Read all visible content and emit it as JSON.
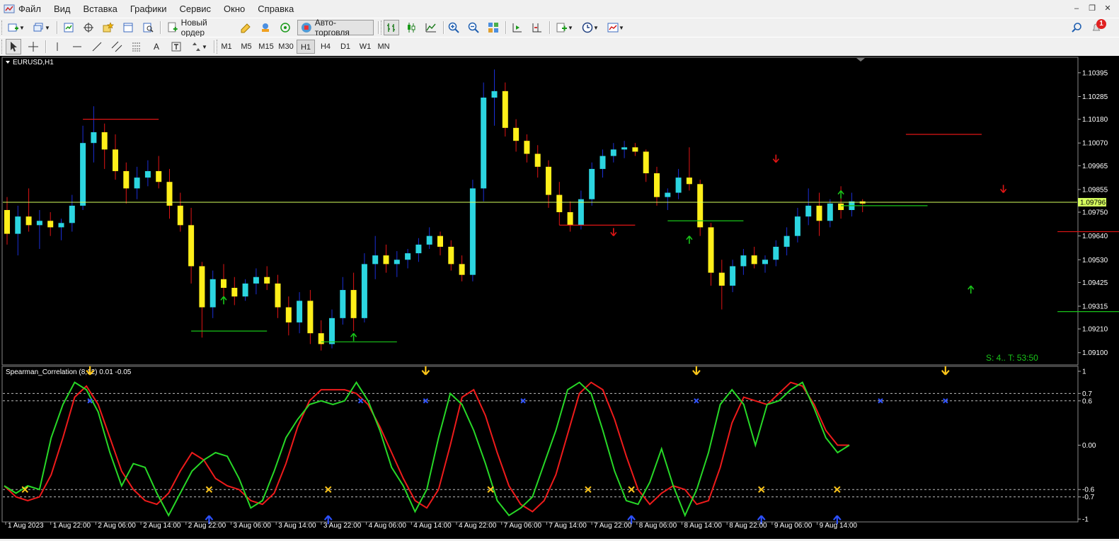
{
  "menu": {
    "items": [
      "Файл",
      "Вид",
      "Вставка",
      "Графики",
      "Сервис",
      "Окно",
      "Справка"
    ]
  },
  "toolbar": {
    "new_order_label": "Новый ордер",
    "autotrading_label": "Авто-торговля",
    "notification_count": "1"
  },
  "timeframes": [
    "M1",
    "M5",
    "M15",
    "M30",
    "H1",
    "H4",
    "D1",
    "W1",
    "MN"
  ],
  "active_timeframe": "H1",
  "chart": {
    "symbol_label": "EURUSD,H1",
    "current_price": "1.09796",
    "timer_text": "S: 4.. T: 53:50",
    "price_ticks": [
      "1.10395",
      "1.10285",
      "1.10180",
      "1.10070",
      "1.09965",
      "1.09855",
      "1.09750",
      "1.09640",
      "1.09530",
      "1.09425",
      "1.09315",
      "1.09210",
      "1.09100"
    ],
    "price_range": [
      1.0905,
      1.1046
    ],
    "colors": {
      "bull": "#2cd5e0",
      "bear": "#ffef1a",
      "bull_wick": "#1a2fd6",
      "bear_wick": "#e01515",
      "bid_line": "#d6ff5e",
      "level_red": "#e01515",
      "level_green": "#19c419"
    },
    "candles": [
      [
        1.0976,
        1.0982,
        1.096,
        1.0965
      ],
      [
        1.0965,
        1.0978,
        1.0955,
        1.0973
      ],
      [
        1.0973,
        1.0986,
        1.0966,
        1.0969
      ],
      [
        1.0969,
        1.0976,
        1.0958,
        1.0971
      ],
      [
        1.0971,
        1.0975,
        1.0964,
        1.0968
      ],
      [
        1.0968,
        1.0972,
        1.0962,
        1.097
      ],
      [
        1.097,
        1.0983,
        1.0966,
        1.0978
      ],
      [
        1.0978,
        1.1015,
        1.0976,
        1.1007
      ],
      [
        1.1007,
        1.1024,
        1.0998,
        1.1012
      ],
      [
        1.1012,
        1.1016,
        1.0995,
        1.1004
      ],
      [
        1.1004,
        1.1011,
        1.099,
        1.0994
      ],
      [
        1.0994,
        1.0998,
        1.0979,
        1.0986
      ],
      [
        1.0986,
        1.0996,
        1.0981,
        1.0991
      ],
      [
        1.0991,
        1.0999,
        1.0987,
        1.0994
      ],
      [
        1.0994,
        1.1001,
        1.0986,
        1.0989
      ],
      [
        1.0989,
        1.0995,
        1.0972,
        1.0978
      ],
      [
        1.0978,
        1.0984,
        1.0966,
        1.0969
      ],
      [
        1.0969,
        1.0977,
        1.0942,
        1.095
      ],
      [
        1.095,
        1.0952,
        1.0917,
        1.0931
      ],
      [
        1.0931,
        1.0948,
        1.0926,
        1.0944
      ],
      [
        1.0944,
        1.0951,
        1.0936,
        1.094
      ],
      [
        1.094,
        1.0945,
        1.0932,
        1.0936
      ],
      [
        1.0936,
        1.0944,
        1.0934,
        1.0942
      ],
      [
        1.0942,
        1.0949,
        1.0937,
        1.0945
      ],
      [
        1.0945,
        1.095,
        1.0939,
        1.0942
      ],
      [
        1.0942,
        1.0946,
        1.0926,
        1.0931
      ],
      [
        1.0931,
        1.0936,
        1.0918,
        1.0924
      ],
      [
        1.0924,
        1.0938,
        1.0919,
        1.0934
      ],
      [
        1.0934,
        1.0939,
        1.0914,
        1.0919
      ],
      [
        1.0919,
        1.0925,
        1.0911,
        1.0914
      ],
      [
        1.0914,
        1.093,
        1.0912,
        1.0926
      ],
      [
        1.0926,
        1.0945,
        1.0923,
        1.0939
      ],
      [
        1.0939,
        1.0947,
        1.092,
        1.0926
      ],
      [
        1.0926,
        1.0956,
        1.0924,
        1.0951
      ],
      [
        1.0951,
        1.0964,
        1.0944,
        1.0955
      ],
      [
        1.0955,
        1.096,
        1.0947,
        1.0951
      ],
      [
        1.0951,
        1.0957,
        1.0945,
        1.0953
      ],
      [
        1.0953,
        1.0958,
        1.0949,
        1.0956
      ],
      [
        1.0956,
        1.0963,
        1.0952,
        1.096
      ],
      [
        1.096,
        1.0968,
        1.0958,
        1.0964
      ],
      [
        1.0964,
        1.0966,
        1.0955,
        1.0959
      ],
      [
        1.0959,
        1.0962,
        1.0948,
        1.0951
      ],
      [
        1.0951,
        1.0955,
        1.0943,
        1.0946
      ],
      [
        1.0946,
        1.099,
        1.0943,
        1.0986
      ],
      [
        1.0986,
        1.1035,
        1.098,
        1.1028
      ],
      [
        1.1028,
        1.1041,
        1.1015,
        1.1031
      ],
      [
        1.1031,
        1.1035,
        1.101,
        1.1014
      ],
      [
        1.1014,
        1.1018,
        1.1003,
        1.1008
      ],
      [
        1.1008,
        1.1011,
        1.0998,
        1.1002
      ],
      [
        1.1002,
        1.1006,
        1.0991,
        1.0996
      ],
      [
        1.0996,
        1.0999,
        1.0977,
        1.0983
      ],
      [
        1.0983,
        1.0989,
        1.0969,
        1.0975
      ],
      [
        1.0975,
        1.098,
        1.0966,
        1.0969
      ],
      [
        1.0969,
        1.0985,
        1.0967,
        1.0981
      ],
      [
        1.0981,
        1.0998,
        1.0978,
        1.0995
      ],
      [
        1.0995,
        1.1004,
        1.0991,
        1.1001
      ],
      [
        1.1001,
        1.1007,
        1.0998,
        1.1004
      ],
      [
        1.1004,
        1.1008,
        1.1,
        1.1005
      ],
      [
        1.1005,
        1.1007,
        1.1001,
        1.1003
      ],
      [
        1.1003,
        1.1004,
        1.0989,
        1.0993
      ],
      [
        1.0993,
        1.0996,
        1.0978,
        1.0982
      ],
      [
        1.0982,
        1.0986,
        1.0976,
        1.0984
      ],
      [
        1.0984,
        1.0995,
        1.0981,
        1.0991
      ],
      [
        1.0991,
        1.1005,
        1.0985,
        1.0988
      ],
      [
        1.0988,
        1.099,
        1.0964,
        1.0968
      ],
      [
        1.0968,
        1.097,
        1.0941,
        1.0947
      ],
      [
        1.0947,
        1.0953,
        1.093,
        1.0941
      ],
      [
        1.0941,
        1.0953,
        1.0938,
        1.095
      ],
      [
        1.095,
        1.0958,
        1.0946,
        1.0955
      ],
      [
        1.0955,
        1.0959,
        1.0949,
        1.0951
      ],
      [
        1.0951,
        1.0955,
        1.0947,
        1.0953
      ],
      [
        1.0953,
        1.0962,
        1.095,
        1.0959
      ],
      [
        1.0959,
        1.0968,
        1.0955,
        1.0964
      ],
      [
        1.0964,
        1.0977,
        1.0961,
        1.0973
      ],
      [
        1.0973,
        1.0986,
        1.0969,
        1.0978
      ],
      [
        1.0978,
        1.0984,
        1.0964,
        1.0971
      ],
      [
        1.0971,
        1.0981,
        1.0968,
        1.0979
      ],
      [
        1.0979,
        1.0987,
        1.0972,
        1.0976
      ],
      [
        1.0976,
        1.0984,
        1.0973,
        1.098
      ],
      [
        1.098,
        1.0981,
        1.0975,
        1.0979
      ]
    ],
    "levels_red": [
      [
        7,
        14,
        1.1018
      ],
      [
        51,
        58,
        1.0969
      ],
      [
        83,
        90,
        1.1011
      ],
      [
        97,
        103,
        1.0966
      ],
      [
        119,
        125,
        1.099
      ]
    ],
    "levels_green": [
      [
        17,
        24,
        1.092
      ],
      [
        29,
        36,
        1.0915
      ],
      [
        61,
        68,
        1.0971
      ],
      [
        77,
        85,
        1.0978
      ],
      [
        97,
        103,
        1.0929
      ]
    ],
    "arrows_up": [
      [
        20,
        1.0934
      ],
      [
        32,
        1.0917
      ],
      [
        63,
        1.0962
      ],
      [
        77,
        1.0983
      ],
      [
        89,
        1.0939
      ]
    ],
    "arrows_down": [
      [
        56,
        1.0966
      ],
      [
        71,
        1.1
      ],
      [
        92,
        1.0986
      ]
    ],
    "candle_count_visible": 80
  },
  "indicator": {
    "label": "Spearman_Correlation (8,12) 0.01 -0.05",
    "scale_ticks": [
      "1",
      "0.7",
      "0.6",
      "0.00",
      "-0.6",
      "-0.7",
      "-1"
    ],
    "fast_line_color": "#27d827",
    "slow_line_color": "#ee1b1b",
    "fast": [
      -0.55,
      -0.65,
      -0.55,
      -0.6,
      0.1,
      0.55,
      0.85,
      0.75,
      0.45,
      -0.1,
      -0.55,
      -0.25,
      -0.3,
      -0.65,
      -0.95,
      -0.65,
      -0.35,
      -0.2,
      -0.1,
      -0.15,
      -0.45,
      -0.85,
      -0.75,
      -0.35,
      0.1,
      0.35,
      0.55,
      0.6,
      0.55,
      0.6,
      0.85,
      0.6,
      0.2,
      -0.3,
      -0.55,
      -0.9,
      -0.6,
      0.1,
      0.7,
      0.55,
      0.2,
      -0.25,
      -0.75,
      -0.95,
      -0.85,
      -0.7,
      -0.25,
      0.2,
      0.75,
      0.85,
      0.7,
      0.2,
      -0.35,
      -0.75,
      -0.8,
      -0.5,
      -0.05,
      -0.55,
      -0.95,
      -0.6,
      -0.1,
      0.55,
      0.75,
      0.55,
      0.0,
      0.55,
      0.6,
      0.75,
      0.85,
      0.5,
      0.1,
      -0.1,
      0.0
    ],
    "slow": [
      -0.55,
      -0.7,
      -0.75,
      -0.7,
      -0.4,
      0.1,
      0.65,
      0.8,
      0.55,
      0.1,
      -0.35,
      -0.6,
      -0.75,
      -0.8,
      -0.65,
      -0.35,
      -0.1,
      -0.2,
      -0.45,
      -0.55,
      -0.6,
      -0.75,
      -0.8,
      -0.65,
      -0.25,
      0.25,
      0.6,
      0.75,
      0.75,
      0.75,
      0.7,
      0.55,
      0.25,
      -0.1,
      -0.45,
      -0.75,
      -0.85,
      -0.6,
      0.0,
      0.65,
      0.75,
      0.4,
      -0.1,
      -0.55,
      -0.8,
      -0.9,
      -0.75,
      -0.4,
      0.15,
      0.7,
      0.85,
      0.75,
      0.35,
      -0.15,
      -0.6,
      -0.8,
      -0.65,
      -0.55,
      -0.6,
      -0.8,
      -0.75,
      -0.3,
      0.3,
      0.65,
      0.6,
      0.55,
      0.7,
      0.85,
      0.8,
      0.55,
      0.2,
      0.0,
      0.0
    ],
    "markers_yellow_x": [
      [
        1,
        -0.6
      ],
      [
        18,
        -0.6
      ],
      [
        29,
        -0.6
      ],
      [
        44,
        -0.6
      ],
      [
        53,
        -0.6
      ],
      [
        57,
        -0.6
      ],
      [
        69,
        -0.6
      ],
      [
        76,
        -0.6
      ]
    ],
    "markers_blue_x": [
      [
        7,
        0.6
      ],
      [
        32,
        0.6
      ],
      [
        38,
        0.6
      ],
      [
        47,
        0.6
      ],
      [
        63,
        0.6
      ],
      [
        80,
        0.6
      ],
      [
        86,
        0.6
      ]
    ],
    "arrows_down": [
      [
        7,
        0.82
      ],
      [
        38,
        0.82
      ],
      [
        63,
        0.82
      ],
      [
        86,
        0.82
      ]
    ],
    "arrows_up": [
      [
        18,
        -0.82
      ],
      [
        29,
        -0.82
      ],
      [
        57,
        -0.82
      ],
      [
        69,
        -0.82
      ],
      [
        76,
        -0.82
      ]
    ]
  },
  "time_axis": [
    "1 Aug 2023",
    "1 Aug 22:00",
    "2 Aug 06:00",
    "2 Aug 14:00",
    "2 Aug 22:00",
    "3 Aug 06:00",
    "3 Aug 14:00",
    "3 Aug 22:00",
    "4 Aug 06:00",
    "4 Aug 14:00",
    "4 Aug 22:00",
    "7 Aug 06:00",
    "7 Aug 14:00",
    "7 Aug 22:00",
    "8 Aug 06:00",
    "8 Aug 14:00",
    "8 Aug 22:00",
    "9 Aug 06:00",
    "9 Aug 14:00"
  ]
}
